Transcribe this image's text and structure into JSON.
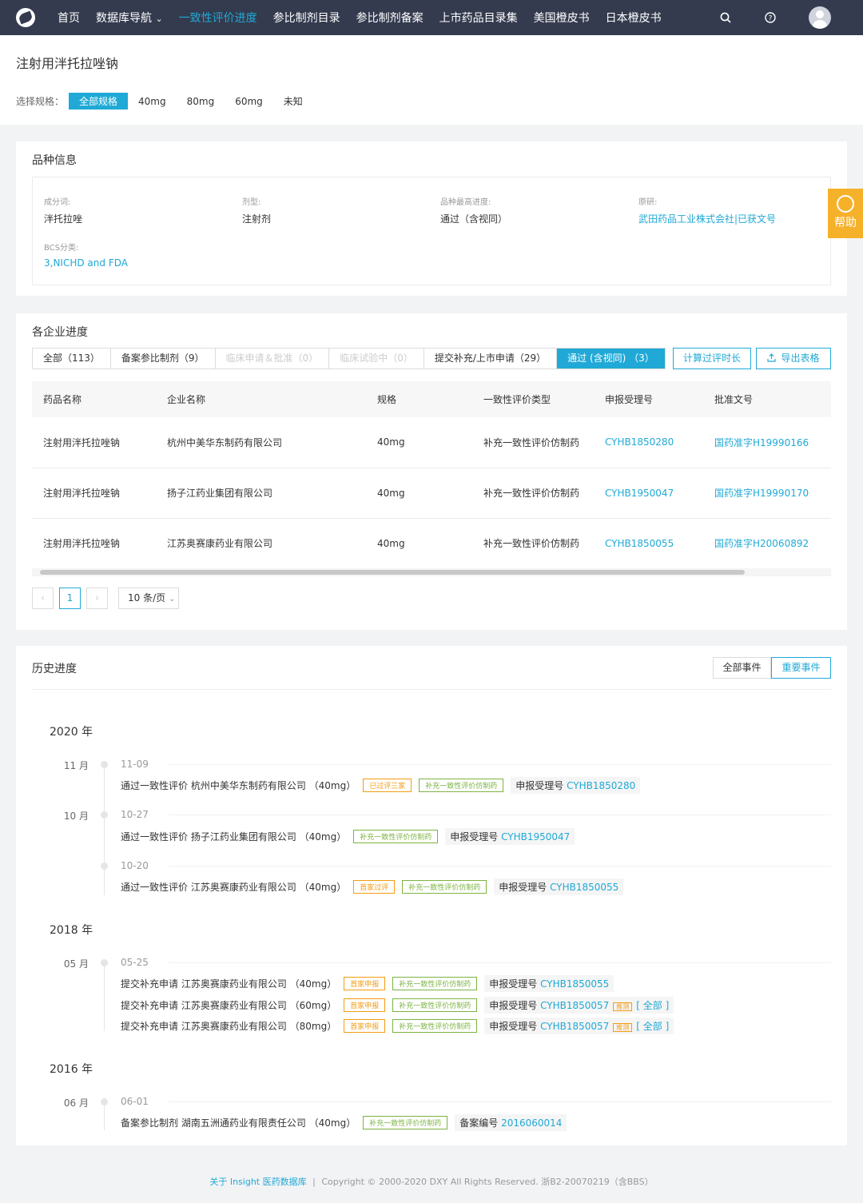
{
  "nav": {
    "items": [
      "首页",
      "数据库导航",
      "一致性评价进度",
      "参比制剂目录",
      "参比制剂备案",
      "上市药品目录集",
      "美国橙皮书",
      "日本橙皮书"
    ],
    "active": "一致性评价进度",
    "dropdown_caret": "⌄"
  },
  "page": {
    "title": "注射用泮托拉唑钠",
    "spec_label": "选择规格：",
    "spec_options": [
      "全部规格",
      "40mg",
      "80mg",
      "60mg",
      "未知"
    ]
  },
  "info": {
    "title": "品种信息",
    "fields": [
      {
        "label": "成分词:",
        "value": "泮托拉唑"
      },
      {
        "label": "剂型:",
        "value": "注射剂"
      },
      {
        "label": "品种最高进度:",
        "value": "通过（含视同）"
      },
      {
        "label": "原研:",
        "value": "武田药品工业株式会社|已获文号"
      },
      {
        "label": "BCS分类:",
        "value": "3,NICHD and FDA"
      }
    ]
  },
  "help": {
    "label": "帮助"
  },
  "progress": {
    "title": "各企业进度",
    "tabs": [
      "全部（113）",
      "备案参比制剂（9）",
      "临床申请＆批准（0）",
      "临床试验中（0）",
      "提交补充/上市申请（29）",
      "通过 (含视同) （3）"
    ],
    "calc_label": "计算过评时长",
    "export_label": "导出表格",
    "columns": [
      "药品名称",
      "企业名称",
      "规格",
      "一致性评价类型",
      "申报受理号",
      "批准文号"
    ],
    "rows": [
      [
        "注射用泮托拉唑钠",
        "杭州中美华东制药有限公司",
        "40mg",
        "补充一致性评价仿制药",
        "CYHB1850280",
        "国药准字H19990166"
      ],
      [
        "注射用泮托拉唑钠",
        "扬子江药业集团有限公司",
        "40mg",
        "补充一致性评价仿制药",
        "CYHB1950047",
        "国药准字H19990170"
      ],
      [
        "注射用泮托拉唑钠",
        "江苏奥赛康药业有限公司",
        "40mg",
        "补充一致性评价仿制药",
        "CYHB1850055",
        "国药准字H20060892"
      ]
    ],
    "pagination": {
      "prev": "‹",
      "current": "1",
      "next": "›",
      "size": "10 条/页"
    }
  },
  "history": {
    "title": "历史进度",
    "filter_all": "全部事件",
    "filter_important": "重要事件",
    "years": [
      "2020 年",
      "2018 年",
      "2016 年"
    ],
    "months": [
      "11 月",
      "10 月",
      "05 月",
      "06 月"
    ],
    "dates": [
      "11-09",
      "10-27",
      "10-20",
      "05-25",
      "06-01"
    ],
    "events": [
      {
        "text": "通过一致性评价 杭州中美华东制药有限公司 （40mg）",
        "tags": [
          "已过评三家",
          "补充一致性评价仿制药"
        ],
        "reg_label": "申报受理号",
        "reg_no": "CYHB1850280"
      },
      {
        "text": "通过一致性评价 扬子江药业集团有限公司 （40mg）",
        "tags": [
          "补充一致性评价仿制药"
        ],
        "reg_label": "申报受理号",
        "reg_no": "CYHB1950047"
      },
      {
        "text": "通过一致性评价 江苏奥赛康药业有限公司 （40mg）",
        "tags": [
          "首家过评",
          "补充一致性评价仿制药"
        ],
        "reg_label": "申报受理号",
        "reg_no": "CYHB1850055"
      },
      {
        "text": "提交补充申请 江苏奥赛康药业有限公司 （40mg）",
        "tags": [
          "首家申报",
          "补充一致性评价仿制药"
        ],
        "reg_label": "申报受理号",
        "reg_no": "CYHB1850055"
      },
      {
        "text": "提交补充申请 江苏奥赛康药业有限公司 （60mg）",
        "tags": [
          "首家申报",
          "补充一致性评价仿制药"
        ],
        "reg_label": "申报受理号",
        "reg_no": "CYHB1850057",
        "mini": "推测",
        "all": "[ 全部 ]"
      },
      {
        "text": "提交补充申请 江苏奥赛康药业有限公司 （80mg）",
        "tags": [
          "首家申报",
          "补充一致性评价仿制药"
        ],
        "reg_label": "申报受理号",
        "reg_no": "CYHB1850057",
        "mini": "推测",
        "all": "[ 全部 ]"
      },
      {
        "text": "备案参比制剂 湖南五洲通药业有限责任公司 （40mg）",
        "tags": [
          "补充一致性评价仿制药"
        ],
        "reg_label": "备案编号",
        "reg_no": "2016060014"
      }
    ]
  },
  "footer": {
    "link": "关于 Insight 医药数据库",
    "sep": "|",
    "copyright": "Copyright © 2000-2020 DXY All Rights Reserved. 浙B2-20070219（含BBS）"
  },
  "colors": {
    "accent": "#20a9d6",
    "nav_bg": "#343b4f",
    "help_bg": "#f6b12a",
    "tag_orange": "#f39c12",
    "tag_green": "#7cb342"
  }
}
